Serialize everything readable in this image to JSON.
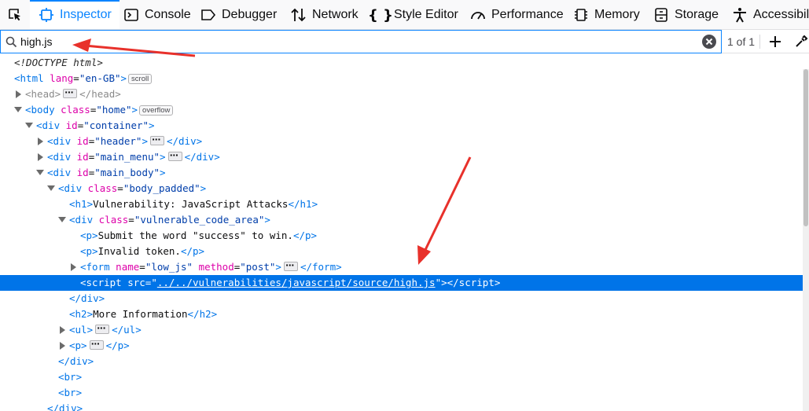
{
  "toolbar": {
    "tabs": [
      {
        "label": "Inspector",
        "icon": "inspector-icon"
      },
      {
        "label": "Console",
        "icon": "console-icon"
      },
      {
        "label": "Debugger",
        "icon": "debugger-icon"
      },
      {
        "label": "Network",
        "icon": "network-icon"
      },
      {
        "label": "Style Editor",
        "icon": "style-editor-icon"
      },
      {
        "label": "Performance",
        "icon": "performance-icon"
      },
      {
        "label": "Memory",
        "icon": "memory-icon"
      },
      {
        "label": "Storage",
        "icon": "storage-icon"
      },
      {
        "label": "Accessibility",
        "icon": "accessibility-icon"
      }
    ],
    "selected_tab": "Inspector"
  },
  "search": {
    "value": "high.js",
    "result_count": "1 of 1"
  },
  "tree": {
    "doctype": "<!DOCTYPE html>",
    "html_tag": "<html",
    "html_attr": "lang",
    "html_val": "\"en-GB\"",
    "scroll_badge": "scroll",
    "head_open": "<head>",
    "head_close": "</head>",
    "body_tag": "<body",
    "body_attr": "class",
    "body_val": "\"home\"",
    "overflow_badge": "overflow",
    "div_container_attr": "id",
    "div_container_val": "\"container\"",
    "header_val": "\"header\"",
    "main_menu_val": "\"main_menu\"",
    "main_body_val": "\"main_body\"",
    "body_padded_val": "\"body_padded\"",
    "h1_text": "Vulnerability: JavaScript Attacks",
    "vulnerable_val": "\"vulnerable_code_area\"",
    "p1_text": "Submit the word \"success\" to win.",
    "p2_text": "Invalid token.",
    "form_name_val": "\"low_js\"",
    "form_method_val": "\"post\"",
    "script_src_val": "../../vulnerabilities/javascript/source/high.js",
    "h2_text": "More Information"
  },
  "colors": {
    "accent": "#0a84ff",
    "selected_row": "#0074e8",
    "annotation_arrow": "#e8312b"
  }
}
